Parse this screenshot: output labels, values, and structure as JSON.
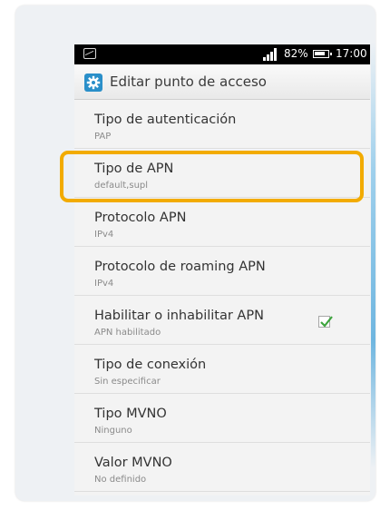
{
  "status_bar": {
    "battery_percent": "82%",
    "time": "17:00",
    "icons": [
      "picture-icon",
      "signal-icon",
      "battery-icon"
    ]
  },
  "title_bar": {
    "title": "Editar punto de acceso",
    "icon": "settings-gear-icon"
  },
  "settings": [
    {
      "title": "Tipo de autenticación",
      "value": "PAP"
    },
    {
      "title": "Tipo de APN",
      "value": "default,supl"
    },
    {
      "title": "Protocolo APN",
      "value": "IPv4"
    },
    {
      "title": "Protocolo de roaming APN",
      "value": "IPv4"
    },
    {
      "title": "Habilitar o inhabilitar APN",
      "value": "APN habilitado",
      "checked": true
    },
    {
      "title": "Tipo de conexión",
      "value": "Sin especificar"
    },
    {
      "title": "Tipo MVNO",
      "value": "Ninguno"
    },
    {
      "title": "Valor MVNO",
      "value": "No definido"
    }
  ],
  "colors": {
    "highlight": "#f2ab00",
    "accent": "#2a8fc9",
    "check": "#3da43d"
  }
}
